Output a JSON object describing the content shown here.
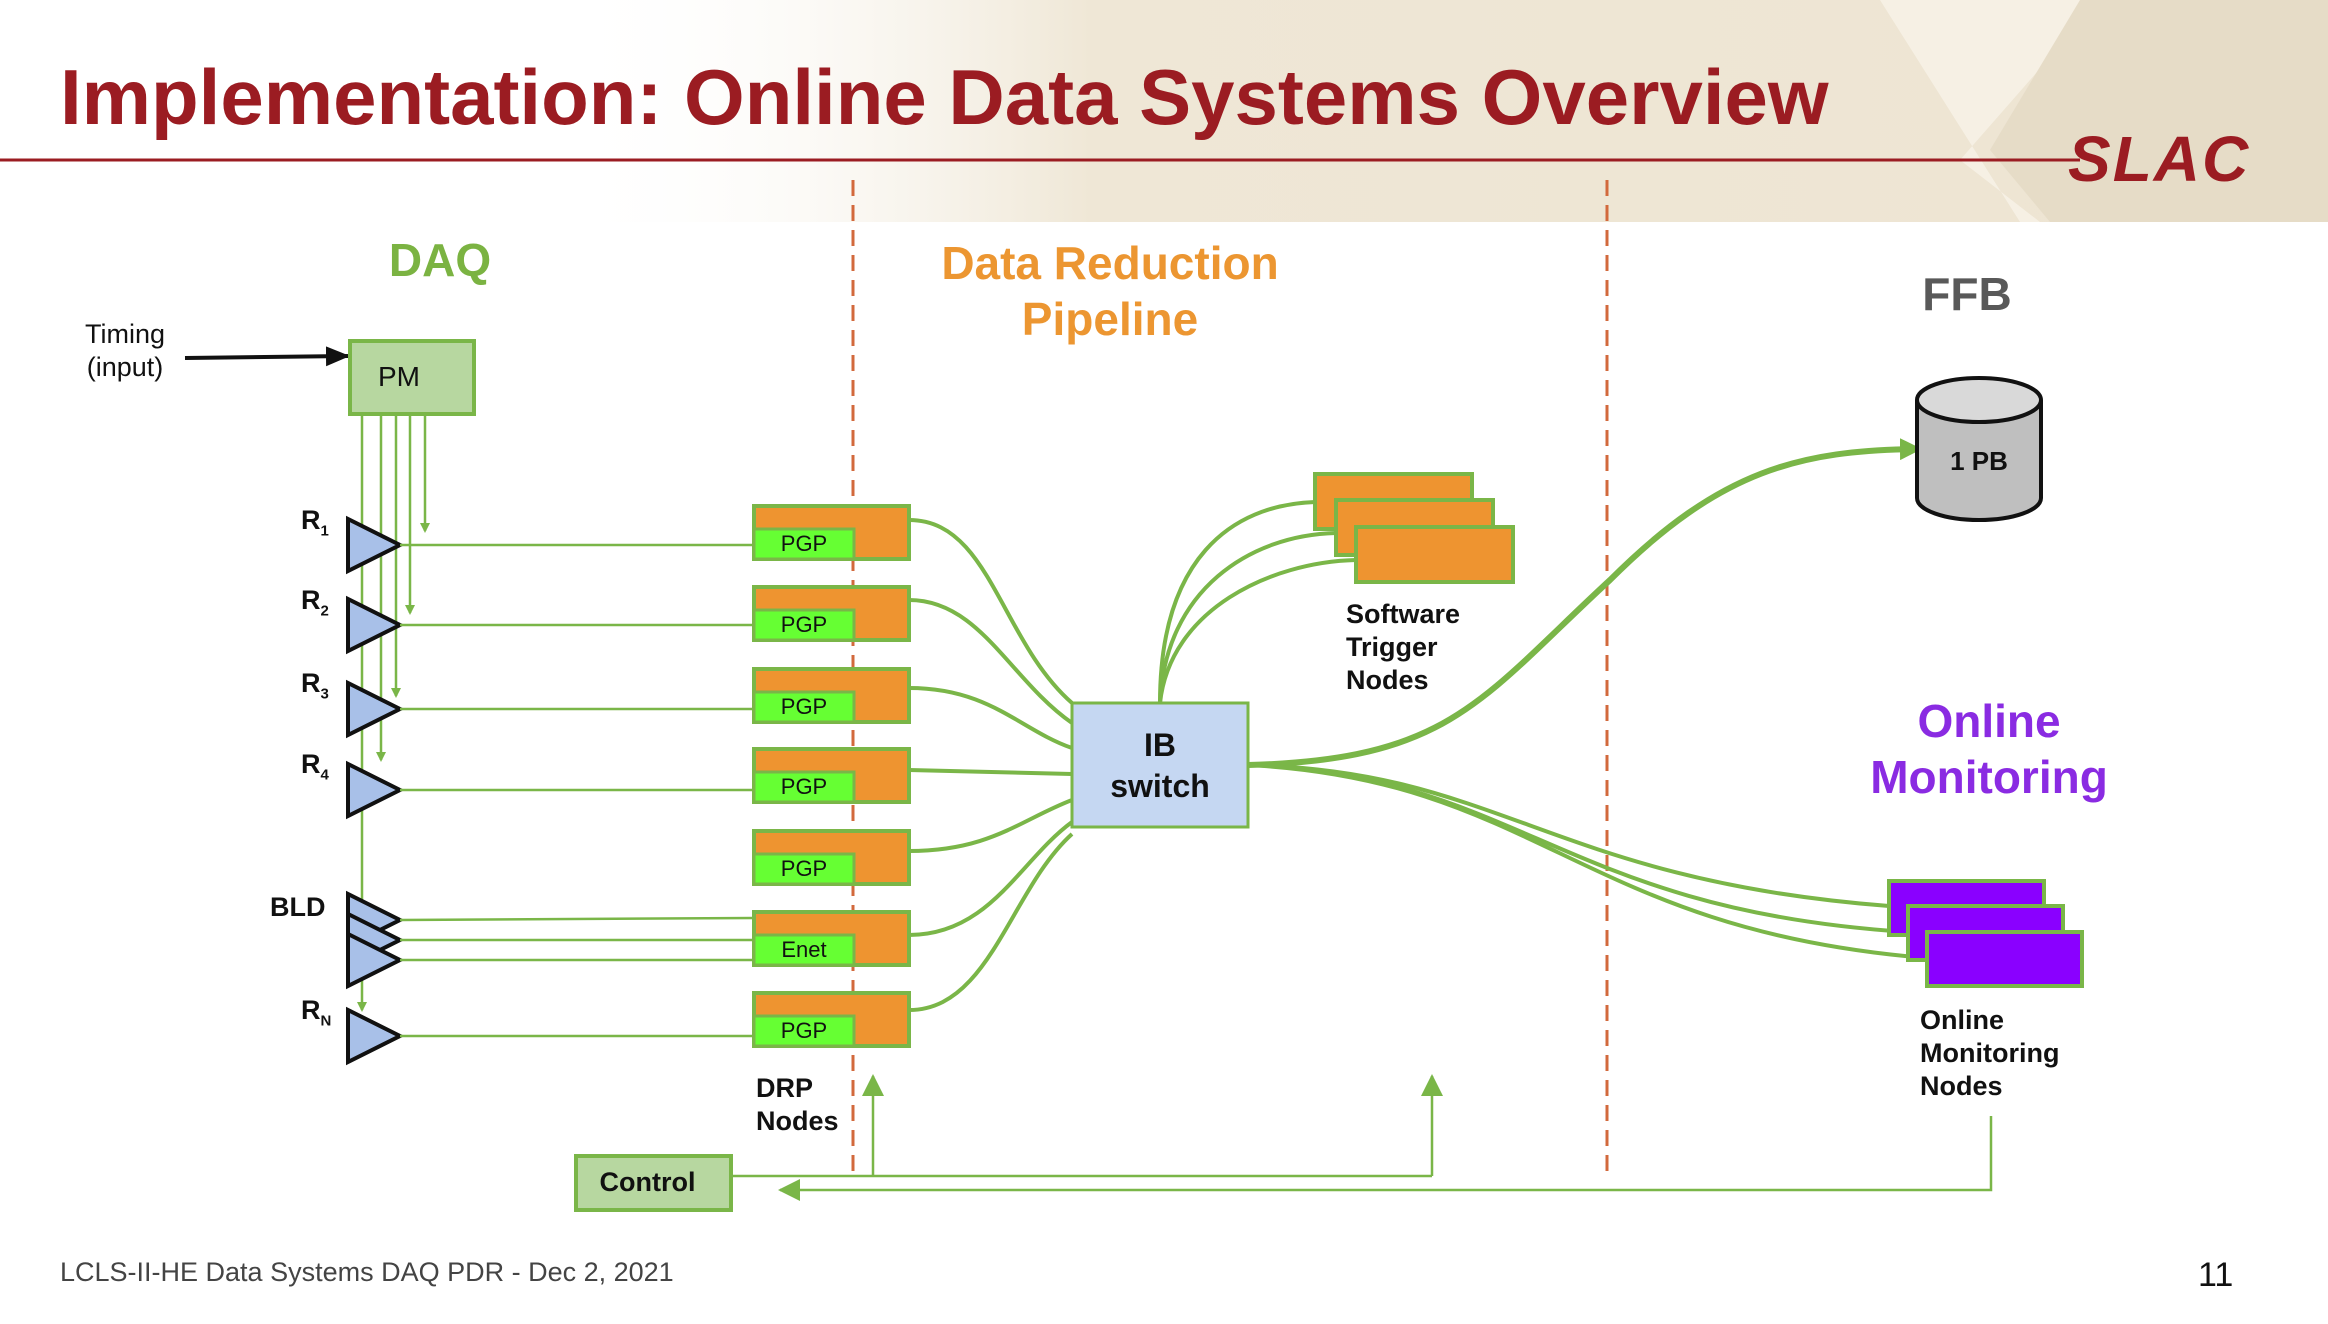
{
  "slide": {
    "title": "Implementation: Online Data Systems Overview",
    "logo_text": "SLAC",
    "footer": "LCLS-II-HE Data Systems DAQ PDR - Dec 2, 2021",
    "page_number": "11"
  },
  "sections": {
    "daq": "DAQ",
    "drp": "Data Reduction Pipeline",
    "ffb": "FFB",
    "online_monitoring": "Online Monitoring"
  },
  "daq": {
    "timing_label": "Timing (input)",
    "pm_label": "PM",
    "receivers": [
      {
        "letter": "R",
        "sub": "1"
      },
      {
        "letter": "R",
        "sub": "2"
      },
      {
        "letter": "R",
        "sub": "3"
      },
      {
        "letter": "R",
        "sub": "4"
      },
      {
        "letter": "BLD",
        "sub": ""
      },
      {
        "letter": "R",
        "sub": "N"
      }
    ]
  },
  "drp": {
    "node_ports": [
      "PGP",
      "PGP",
      "PGP",
      "PGP",
      "PGP",
      "Enet",
      "PGP"
    ],
    "nodes_label": "DRP Nodes",
    "switch_label": "IB switch",
    "software_trigger_label": "Software Trigger Nodes"
  },
  "ffb": {
    "storage_label": "1 PB"
  },
  "monitoring": {
    "nodes_label": "Online Monitoring Nodes"
  },
  "control": {
    "label": "Control"
  },
  "colors": {
    "title_red": "#9b1c22",
    "daq_green": "#7bb342",
    "drp_orange": "#ec9631",
    "ffb_gray": "#595959",
    "monitor_purple": "#8a2be2",
    "link_green": "#7ab648",
    "port_green": "#66ff33",
    "switch_blue": "#c5d7f2",
    "receiver_blue": "#a8c0e8",
    "box_orange": "#ee9430",
    "pm_green": "#b7d7a0",
    "divider_orange": "#d2693c"
  }
}
